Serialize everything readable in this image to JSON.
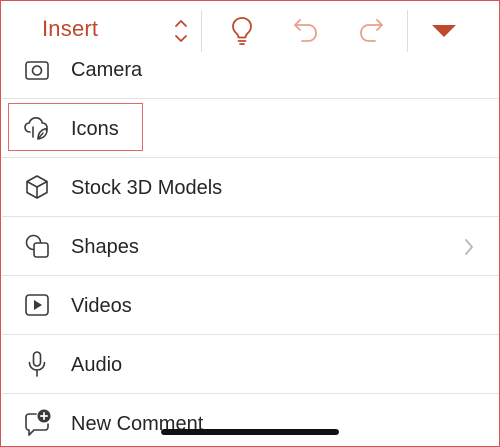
{
  "toolbar": {
    "tab_selector_label": "Insert",
    "icons": [
      "updown-chevron-icon",
      "lightbulb-icon",
      "undo-icon",
      "redo-icon",
      "dropdown-triangle-icon"
    ],
    "accent_color": "#c0492c"
  },
  "menu": {
    "items": [
      {
        "label": "Camera",
        "icon": "camera-icon"
      },
      {
        "label": "Icons",
        "icon": "icons-icon",
        "highlighted": true
      },
      {
        "label": "Stock 3D Models",
        "icon": "cube-icon"
      },
      {
        "label": "Shapes",
        "icon": "shapes-icon",
        "has_submenu": true
      },
      {
        "label": "Videos",
        "icon": "video-icon"
      },
      {
        "label": "Audio",
        "icon": "microphone-icon"
      },
      {
        "label": "New Comment",
        "icon": "new-comment-icon"
      }
    ]
  },
  "colors": {
    "highlight_border": "#e06a6a",
    "frame_border": "#d9534f",
    "text": "#262626",
    "icon_stroke": "#3a3a3a"
  }
}
